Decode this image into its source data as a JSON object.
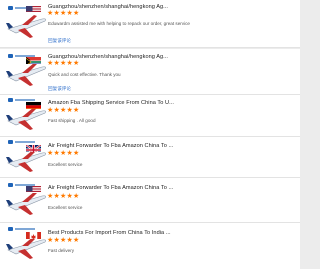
{
  "colors": {
    "star": "#ff7a00",
    "link": "#2f6fcb"
  },
  "listings": [
    {
      "flag": "us",
      "title": "Guangzhou/shenzhen/shanghai/hengkong Ag...",
      "stars": "★★★★★",
      "rating": 5,
      "review": "Eduwardm assisted me with helping to repack our order, great service",
      "link": "回复该评论"
    },
    {
      "flag": "za",
      "title": "Guangzhou/shenzhen/shanghai/hengkong Ag...",
      "stars": "★★★★★",
      "rating": 5,
      "review": "Quick and cost effective. Thank you",
      "link": "回复该评论"
    },
    {
      "flag": "de",
      "title": "Amazon Fba Shipping Service From China To U...",
      "stars": "★★★★★",
      "rating": 5,
      "review": "Fast shipping . All good"
    },
    {
      "flag": "uk",
      "title": "Air Freight Forwarder To Fba Amazon China To ...",
      "stars": "★★★★★",
      "rating": 5,
      "review": "Excellent service"
    },
    {
      "flag": "us",
      "title": "Air Freight Forwarder To Fba Amazon China To ...",
      "stars": "★★★★★",
      "rating": 5,
      "review": "Excellent service"
    },
    {
      "flag": "ca",
      "title": "Best Products For Import From China To India ...",
      "stars": "★★★★★",
      "rating": 5,
      "review": "Fast delivery"
    }
  ]
}
